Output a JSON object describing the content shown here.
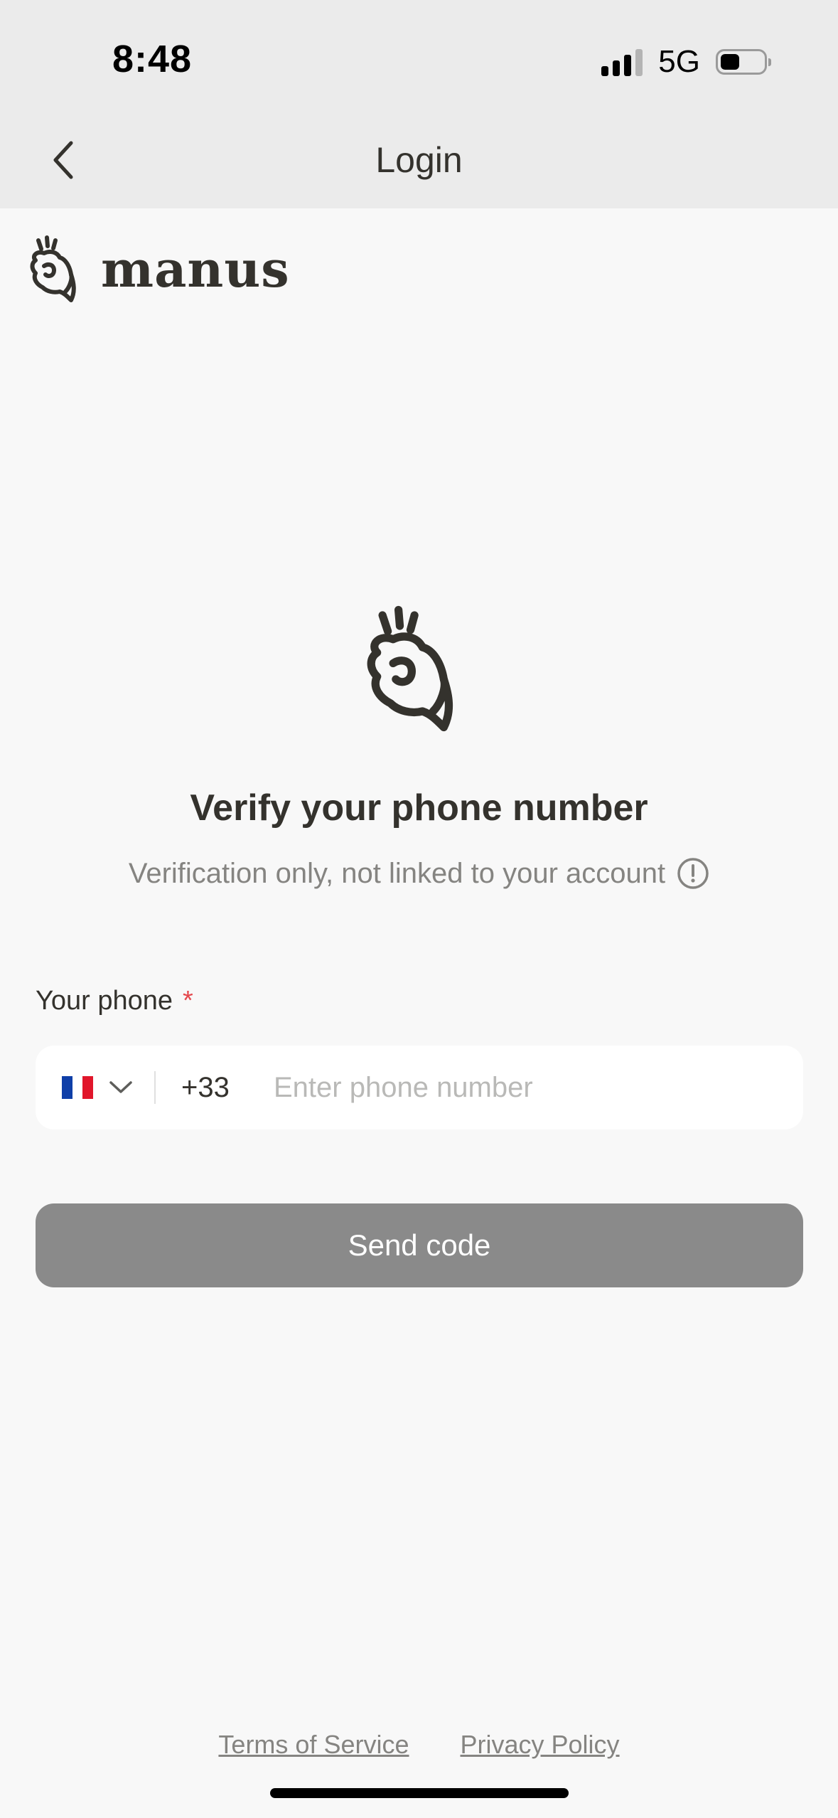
{
  "status_bar": {
    "time": "8:48",
    "network": "5G",
    "signal_bars_active": 3,
    "signal_bars_total": 4,
    "battery_level": 0.45
  },
  "header": {
    "title": "Login",
    "back_icon": "chevron-left-icon"
  },
  "brand": {
    "name": "manus",
    "logo_icon": "manus-hand-logo-icon"
  },
  "verify": {
    "heading": "Verify your phone number",
    "subheading": "Verification only, not linked to your account",
    "info_icon": "info-circle-icon"
  },
  "phone_field": {
    "label": "Your phone",
    "required_mark": "*",
    "country_flag": "france-flag-icon",
    "dial_code": "+33",
    "value": "",
    "placeholder": "Enter phone number"
  },
  "actions": {
    "send_code_label": "Send code"
  },
  "footer": {
    "terms_label": "Terms of Service",
    "privacy_label": "Privacy Policy"
  },
  "colors": {
    "text_primary": "#34322d",
    "text_secondary": "#858481",
    "button_disabled": "#8a8a8a",
    "required": "#e5484d",
    "header_bg": "#ebebeb",
    "page_bg": "#f8f8f8",
    "flag_blue": "#0f3fa8",
    "flag_white": "#ffffff",
    "flag_red": "#e1162b"
  }
}
